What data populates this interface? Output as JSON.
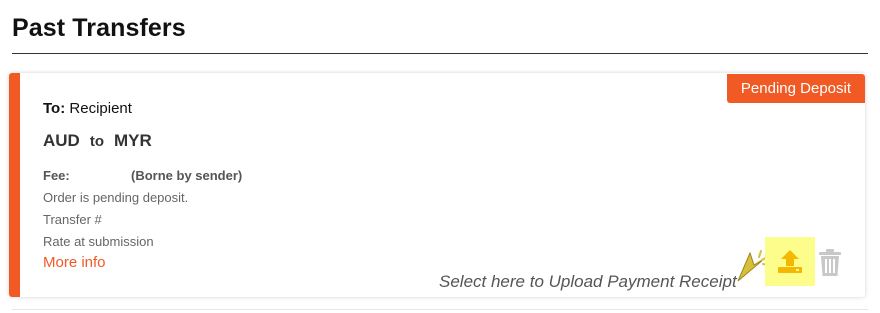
{
  "page": {
    "title": "Past Transfers"
  },
  "transfer": {
    "status_badge": "Pending Deposit",
    "to_label": "To:",
    "recipient": "Recipient",
    "from_currency": "AUD",
    "to_word": "to",
    "to_currency": "MYR",
    "fee_label": "Fee:",
    "fee_value": "",
    "fee_note": "(Borne by sender)",
    "pending_message": "Order is pending deposit.",
    "transfer_number_label": "Transfer #",
    "rate_label": "Rate at submission",
    "more_info_link": "More info",
    "upload_hint": "Select here to Upload Payment Receipt"
  },
  "icons": {
    "upload": "upload-icon",
    "delete": "trash-icon",
    "pointer": "cursor-pointer-icon"
  },
  "colors": {
    "accent": "#f15a24",
    "highlight": "#fdfd8c",
    "upload_icon": "#f5b800",
    "trash_icon": "#c8c8c8"
  }
}
